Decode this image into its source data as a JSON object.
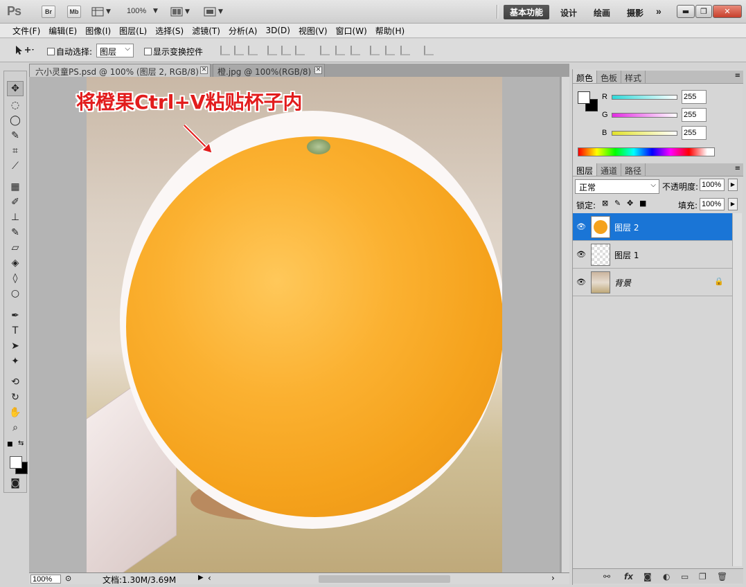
{
  "app": {
    "logo": "Ps",
    "bridge_label": "Br",
    "minibridge_label": "Mb",
    "zoom": "100%",
    "workspaces": [
      "基本功能",
      "设计",
      "绘画",
      "摄影"
    ],
    "active_workspace": "基本功能",
    "more": "»"
  },
  "menu": [
    "文件(F)",
    "编辑(E)",
    "图像(I)",
    "图层(L)",
    "选择(S)",
    "滤镜(T)",
    "分析(A)",
    "3D(D)",
    "视图(V)",
    "窗口(W)",
    "帮助(H)"
  ],
  "options": {
    "auto_select_label": "自动选择:",
    "auto_select_value": "图层",
    "show_transform_label": "显示变换控件"
  },
  "documents": {
    "tabs": [
      "六小灵童PS.psd @ 100% (图层 2, RGB/8) *",
      "橙.jpg @ 100%(RGB/8) *"
    ],
    "annotation": "将橙果Ctrl+V粘贴杯子内",
    "status_zoom": "100%",
    "doc_size": "文档:1.30M/3.69M"
  },
  "color_panel": {
    "tabs": [
      "颜色",
      "色板",
      "样式"
    ],
    "channels": [
      {
        "label": "R",
        "value": "255",
        "color": "#2fd8d8"
      },
      {
        "label": "G",
        "value": "255",
        "color": "#e22be2"
      },
      {
        "label": "B",
        "value": "255",
        "color": "#e2e22b"
      }
    ]
  },
  "layers_panel": {
    "tabs": [
      "图层",
      "通道",
      "路径"
    ],
    "blend_mode": "正常",
    "opacity_label": "不透明度:",
    "opacity_value": "100%",
    "lock_label": "锁定:",
    "fill_label": "填充:",
    "fill_value": "100%",
    "layers": [
      {
        "name": "图层 2",
        "selected": true
      },
      {
        "name": "图层 1",
        "selected": false
      },
      {
        "name": "背景",
        "selected": false
      }
    ]
  },
  "colors": {
    "selection_blue": "#1a75d6",
    "annotation_red": "#e21d1d",
    "orange": "#f5a21c"
  }
}
